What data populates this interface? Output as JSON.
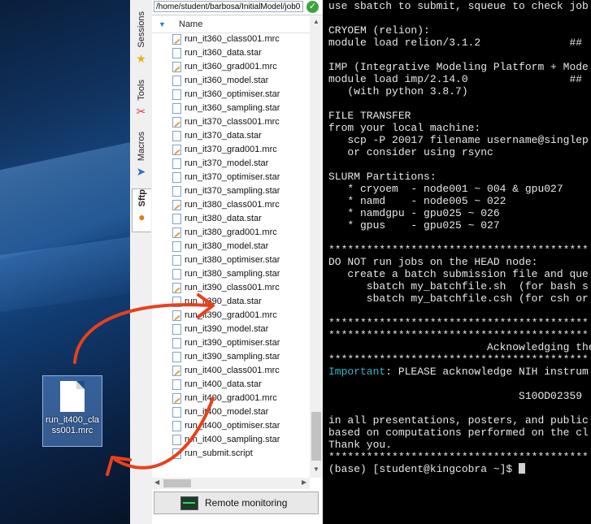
{
  "desktop": {
    "file_label": "run_it400_class001.mrc"
  },
  "sidetabs": [
    {
      "label": "Sessions",
      "icon": "star-icon"
    },
    {
      "label": "Tools",
      "icon": "tools-icon"
    },
    {
      "label": "Macros",
      "icon": "paper-plane-icon"
    },
    {
      "label": "Sftp",
      "icon": "sftp-icon"
    }
  ],
  "sftp": {
    "path": "/home/student/barbosa/InitialModel/job0",
    "column_name": "Name",
    "files": [
      {
        "name": "run_it360_class001.mrc",
        "type": "mrc"
      },
      {
        "name": "run_it360_data.star",
        "type": "star"
      },
      {
        "name": "run_it360_grad001.mrc",
        "type": "mrc"
      },
      {
        "name": "run_it360_model.star",
        "type": "star"
      },
      {
        "name": "run_it360_optimiser.star",
        "type": "star"
      },
      {
        "name": "run_it360_sampling.star",
        "type": "star"
      },
      {
        "name": "run_it370_class001.mrc",
        "type": "mrc"
      },
      {
        "name": "run_it370_data.star",
        "type": "star"
      },
      {
        "name": "run_it370_grad001.mrc",
        "type": "mrc"
      },
      {
        "name": "run_it370_model.star",
        "type": "star"
      },
      {
        "name": "run_it370_optimiser.star",
        "type": "star"
      },
      {
        "name": "run_it370_sampling.star",
        "type": "star"
      },
      {
        "name": "run_it380_class001.mrc",
        "type": "mrc"
      },
      {
        "name": "run_it380_data.star",
        "type": "star"
      },
      {
        "name": "run_it380_grad001.mrc",
        "type": "mrc"
      },
      {
        "name": "run_it380_model.star",
        "type": "star"
      },
      {
        "name": "run_it380_optimiser.star",
        "type": "star"
      },
      {
        "name": "run_it380_sampling.star",
        "type": "star"
      },
      {
        "name": "run_it390_class001.mrc",
        "type": "mrc"
      },
      {
        "name": "run_it390_data.star",
        "type": "star"
      },
      {
        "name": "run_it390_grad001.mrc",
        "type": "mrc"
      },
      {
        "name": "run_it390_model.star",
        "type": "star"
      },
      {
        "name": "run_it390_optimiser.star",
        "type": "star"
      },
      {
        "name": "run_it390_sampling.star",
        "type": "star"
      },
      {
        "name": "run_it400_class001.mrc",
        "type": "mrc"
      },
      {
        "name": "run_it400_data.star",
        "type": "star"
      },
      {
        "name": "run_it400_grad001.mrc",
        "type": "mrc"
      },
      {
        "name": "run_it400_model.star",
        "type": "star"
      },
      {
        "name": "run_it400_optimiser.star",
        "type": "star"
      },
      {
        "name": "run_it400_sampling.star",
        "type": "star"
      },
      {
        "name": "run_submit.script",
        "type": "script"
      }
    ],
    "remote_button": "Remote monitoring"
  },
  "terminal": {
    "lines": [
      "use sbatch to submit, squeue to check job",
      "",
      "CRYOEM (relion):",
      "module load relion/3.1.2              ##",
      "",
      "IMP (Integrative Modeling Platform + Mode",
      "module load imp/2.14.0                ##",
      "   (with python 3.8.7)",
      "",
      "FILE TRANSFER",
      "from your local machine:",
      "   scp -P 20017 filename username@singlep",
      "   or consider using rsync",
      "",
      "SLURM Partitions:",
      "   * cryoem  - node001 ~ 004 & gpu027",
      "   * namd    - node005 ~ 022",
      "   * namdgpu - gpu025 ~ 026",
      "   * gpus    - gpu025 ~ 027",
      "",
      "*****************************************",
      "DO NOT run jobs on the HEAD node:",
      "   create a batch submission file and que",
      "      sbatch my_batchfile.sh  (for bash s",
      "      sbatch my_batchfile.csh (for csh or",
      "",
      "*****************************************",
      "*****************************************",
      "                         Acknowledging the",
      "*****************************************",
      "Important: PLEASE acknowledge NIH instrum",
      "",
      "                              S10OD02359",
      "",
      "in all presentations, posters, and public",
      "based on computations performed on the cl",
      "Thank you.",
      "*****************************************",
      "(base) [student@kingcobra ~]$ "
    ],
    "highlight_word": "Important",
    "text_color": "#e8e8e8",
    "highlight_color": "#2fb8c8"
  },
  "annotation": {
    "arrow_color": "#e8401c"
  }
}
